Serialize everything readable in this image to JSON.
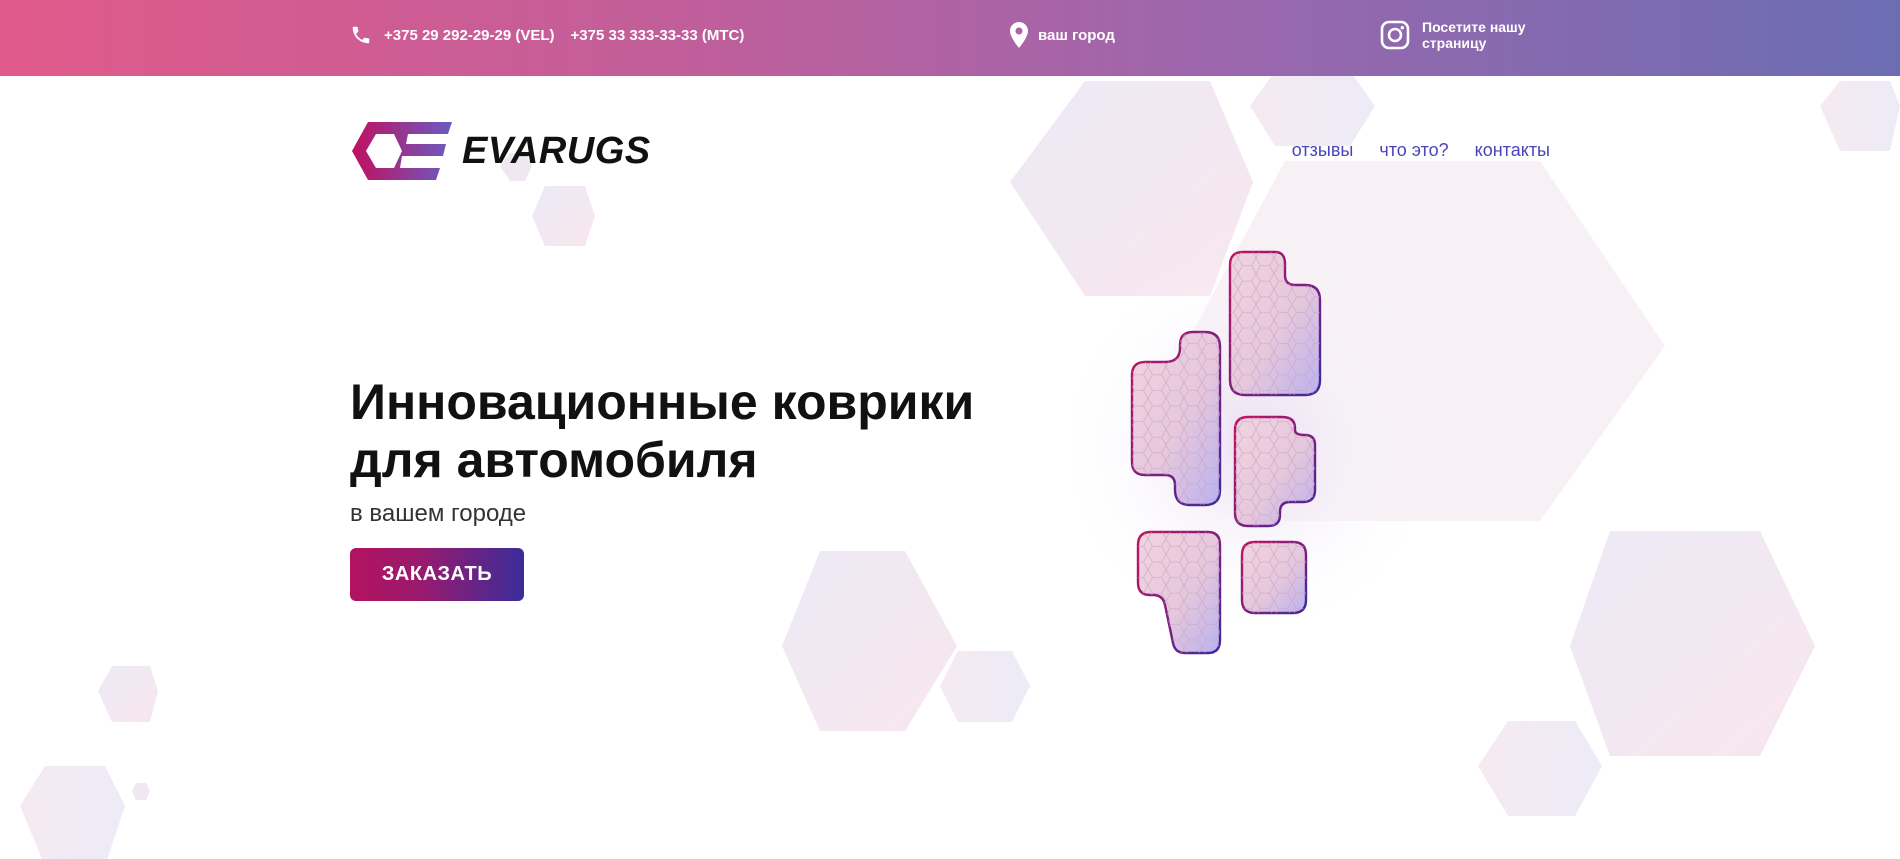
{
  "topbar": {
    "phone_1": "+375 29 292-29-29 (VEL)",
    "phone_2": "+375 33 333-33-33 (МТС)",
    "city": "ваш город",
    "instagram_text": "Посетите нашу страницу"
  },
  "brand": {
    "name": "EVARUGS",
    "colors": {
      "pink": "#c0105f",
      "violet": "#3a2c9a"
    }
  },
  "nav": {
    "reviews": "отзывы",
    "what": "что это?",
    "contacts": "контакты"
  },
  "hero": {
    "title": "Инновационные коврики для автомобиля",
    "subtitle": "в вашем городе",
    "cta": "ЗАКАЗАТЬ"
  },
  "icons": [
    "phone-icon",
    "location-pin-icon",
    "instagram-icon",
    "logo-hexagon-icon"
  ]
}
